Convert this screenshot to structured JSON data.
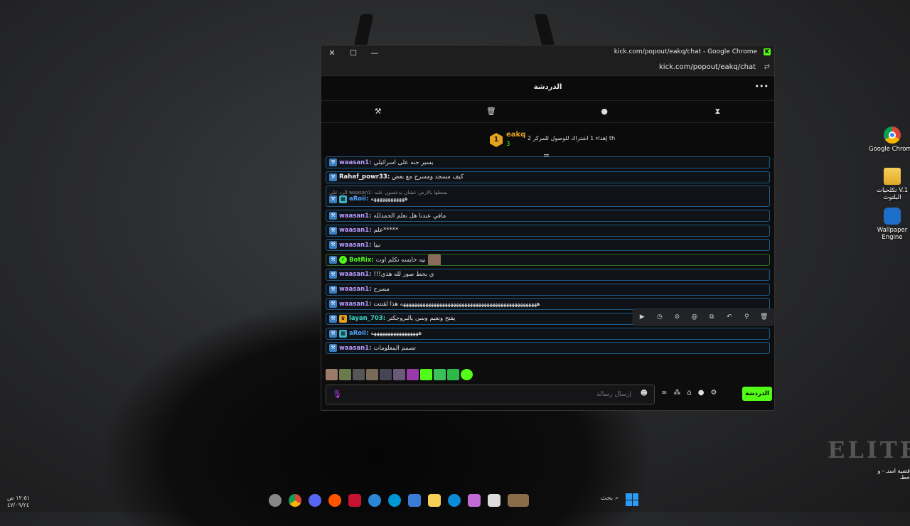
{
  "desktop": {
    "icons": [
      {
        "label": "Google Chrome"
      },
      {
        "label": "تكلحيات V.1 البلتوث"
      },
      {
        "label": "Wallpaper Engine"
      }
    ],
    "logo_text": "ELITE",
    "notification": "قضية استـ - و خطـ"
  },
  "window": {
    "title": "kick.com/popout/eakq/chat - Google Chrome",
    "url": "kick.com/popout/eakq/chat",
    "close": "✕",
    "maximize": "☐",
    "minimize": "—"
  },
  "chat": {
    "header_title": "الدردشة",
    "more": "•••",
    "pinned": {
      "badge": "1",
      "name": "eakq",
      "subs": "3",
      "text": "إهداء 1 اشتراك للوصول للمركز 2 th"
    },
    "messages": [
      {
        "user": "waasan1:",
        "text": "يسير جنه على اسرائيلي",
        "ucolor": "u-purple"
      },
      {
        "user": "Rahaf_powr33:",
        "text": "كيف مسجد ومسرح مع بعض",
        "ucolor": "u-white"
      },
      {
        "reply": "الرد على waasan1: بسطها بالارض عشان يدعسون عليه",
        "user": "aRoii:",
        "text": "ههههههههههههه",
        "ucolor": "u-blue",
        "sub": true
      },
      {
        "user": "waasan1:",
        "text": "مافي عندنا هل نعلم الحمدلله",
        "ucolor": "u-purple"
      },
      {
        "user": "waasan1:",
        "text": "علم*****",
        "ucolor": "u-purple"
      },
      {
        "user": "waasan1:",
        "text": "نبيا",
        "ucolor": "u-purple"
      },
      {
        "user": "BotRix:",
        "text": "نيه خايسه تكلم اوت",
        "ucolor": "u-green",
        "bot": true
      },
      {
        "user": "waasan1:",
        "text": "!!!ي بحط صور لله هذي",
        "ucolor": "u-purple"
      },
      {
        "user": "waasan1:",
        "text": "مسرح",
        "ucolor": "u-purple"
      },
      {
        "user": "waasan1:",
        "text": "هههههههههههههههههههههههههههههههههههههههههههههههههه هذا لقتتت",
        "ucolor": "u-purple"
      },
      {
        "user": "layan_703:",
        "text": "يفتح ونعيم وسن بالبروجكتر",
        "ucolor": "u-teal",
        "crown": true
      },
      {
        "user": "aRoii:",
        "text": "هههههههههههههههههه",
        "ucolor": "u-blue",
        "sub": true
      },
      {
        "user": "waasan1:",
        "text": "تصمم المعلومات",
        "ucolor": "u-purple"
      }
    ],
    "input_placeholder": "إرسال رسالة",
    "send_label": "الدردشة"
  },
  "taskbar": {
    "time": "١٢:٥١ ص",
    "date": "٤٧/٠٩/٢٤",
    "search": "بحث"
  }
}
